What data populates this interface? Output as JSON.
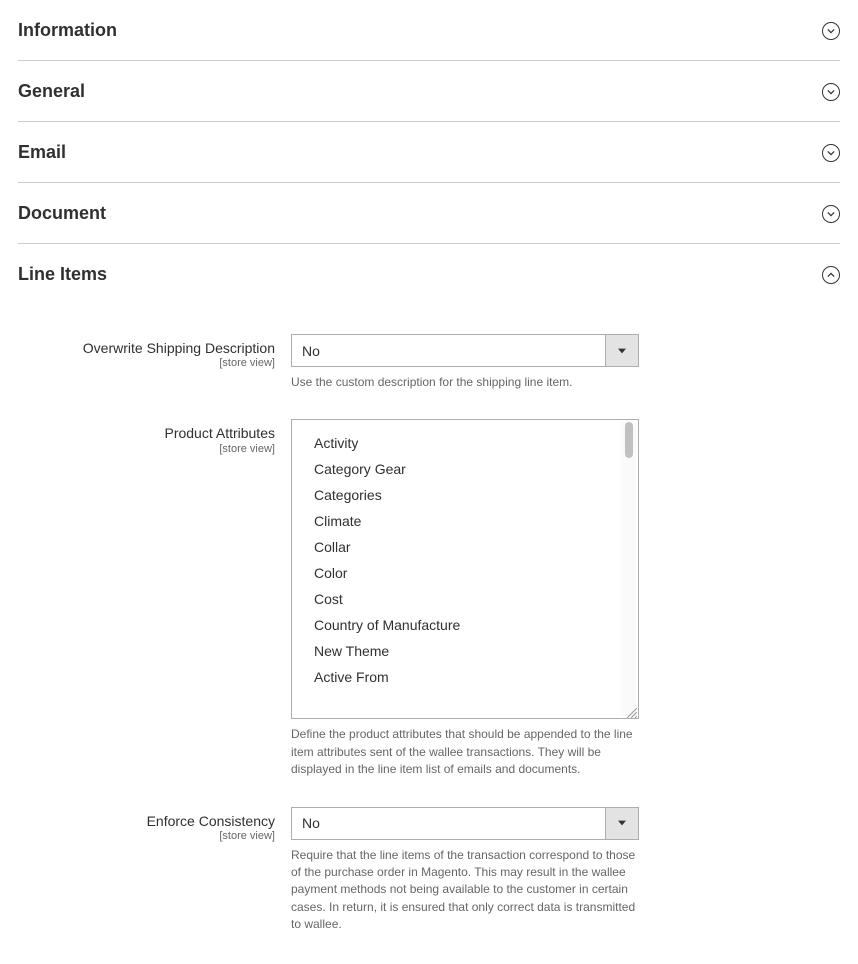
{
  "sections": {
    "information": {
      "title": "Information"
    },
    "general": {
      "title": "General"
    },
    "email": {
      "title": "Email"
    },
    "document": {
      "title": "Document"
    },
    "lineitems": {
      "title": "Line Items"
    }
  },
  "scope_label": "[store view]",
  "fields": {
    "overwrite_shipping": {
      "label": "Overwrite Shipping Description",
      "value": "No",
      "note": "Use the custom description for the shipping line item."
    },
    "product_attributes": {
      "label": "Product Attributes",
      "options": [
        "Activity",
        "Category Gear",
        "Categories",
        "Climate",
        "Collar",
        "Color",
        "Cost",
        "Country of Manufacture",
        "New Theme",
        "Active From"
      ],
      "note": "Define the product attributes that should be appended to the line item attributes sent of the wallee transactions. They will be displayed in the line item list of emails and documents."
    },
    "enforce_consistency": {
      "label": "Enforce Consistency",
      "value": "No",
      "note": "Require that the line items of the transaction correspond to those of the purchase order in Magento. This may result in the wallee payment methods not being available to the customer in certain cases. In return, it is ensured that only correct data is transmitted to wallee."
    }
  }
}
